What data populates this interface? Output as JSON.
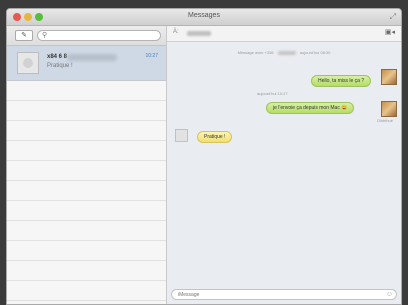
{
  "window": {
    "title": "Messages"
  },
  "sidebar": {
    "compose_icon": "compose-icon",
    "search": {
      "placeholder": "",
      "value": ""
    },
    "conversations": [
      {
        "name": "x84 6 8",
        "time": "10:27",
        "preview": "Pratique !"
      }
    ]
  },
  "chat": {
    "to_label": "À:",
    "system_line": {
      "left": "Message avec +336",
      "right": "aujourd'hui 08:30"
    },
    "messages": [
      {
        "direction": "sent",
        "text": "Hello, ta miss le ça ?"
      },
      {
        "direction": "timestamp",
        "text": "aujourd'hui 10:27"
      },
      {
        "direction": "sent",
        "text": "je l'envoie ça depuis mon Mac 😄"
      },
      {
        "direction": "status",
        "text": "Distribué"
      },
      {
        "direction": "received",
        "text": "Pratique !"
      }
    ],
    "input": {
      "placeholder": "iMessage"
    }
  },
  "colors": {
    "sent_bubble": "#b4dd67",
    "received_bubble": "#f1df6f",
    "selected_conversation": "#cfd9e6"
  }
}
